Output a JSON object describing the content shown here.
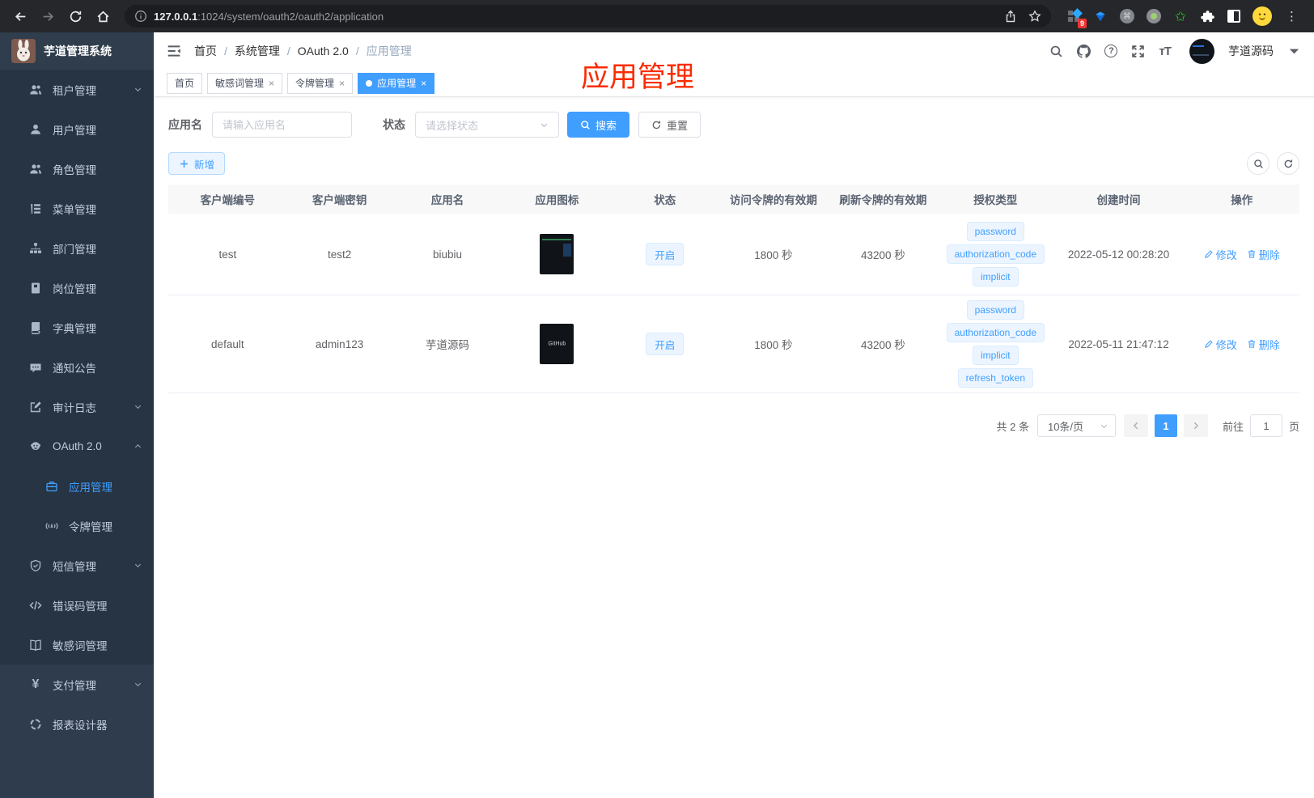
{
  "colors": {
    "accent": "#409eff",
    "annotation_red": "#fb2b00",
    "sidebar_bg": "#273444",
    "tag_bg": "#ecf5ff"
  },
  "browser": {
    "url_host": "127.0.0.1",
    "url_rest": ":1024/system/oauth2/oauth2/application",
    "ext_badge": "9"
  },
  "sidebar": {
    "title": "芋道管理系统",
    "items": [
      {
        "icon": "users-icon",
        "label": "租户管理",
        "chevron": "down",
        "sub": false,
        "light": false,
        "active": false
      },
      {
        "icon": "user-icon",
        "label": "用户管理",
        "chevron": "",
        "sub": false,
        "light": false,
        "active": false
      },
      {
        "icon": "role-icon",
        "label": "角色管理",
        "chevron": "",
        "sub": false,
        "light": false,
        "active": false
      },
      {
        "icon": "menu-tree-icon",
        "label": "菜单管理",
        "chevron": "",
        "sub": false,
        "light": false,
        "active": false
      },
      {
        "icon": "org-icon",
        "label": "部门管理",
        "chevron": "",
        "sub": false,
        "light": false,
        "active": false
      },
      {
        "icon": "badge-icon",
        "label": "岗位管理",
        "chevron": "",
        "sub": false,
        "light": false,
        "active": false
      },
      {
        "icon": "dict-icon",
        "label": "字典管理",
        "chevron": "",
        "sub": false,
        "light": false,
        "active": false
      },
      {
        "icon": "notice-icon",
        "label": "通知公告",
        "chevron": "",
        "sub": false,
        "light": false,
        "active": false
      },
      {
        "icon": "audit-icon",
        "label": "审计日志",
        "chevron": "down",
        "sub": false,
        "light": false,
        "active": false
      },
      {
        "icon": "oauth-icon",
        "label": "OAuth 2.0",
        "chevron": "up",
        "sub": false,
        "light": false,
        "active": false
      },
      {
        "icon": "briefcase-icon",
        "label": "应用管理",
        "chevron": "",
        "sub": true,
        "light": false,
        "active": true
      },
      {
        "icon": "token-icon",
        "label": "令牌管理",
        "chevron": "",
        "sub": true,
        "light": false,
        "active": false
      },
      {
        "icon": "shield-icon",
        "label": "短信管理",
        "chevron": "down",
        "sub": false,
        "light": false,
        "active": false
      },
      {
        "icon": "code-icon",
        "label": "错误码管理",
        "chevron": "",
        "sub": false,
        "light": false,
        "active": false
      },
      {
        "icon": "book-icon",
        "label": "敏感词管理",
        "chevron": "",
        "sub": false,
        "light": false,
        "active": false
      },
      {
        "icon": "yen-icon",
        "label": "支付管理",
        "chevron": "down",
        "sub": false,
        "light": true,
        "active": false
      },
      {
        "icon": "report-icon",
        "label": "报表设计器",
        "chevron": "",
        "sub": false,
        "light": true,
        "active": false
      }
    ]
  },
  "navbar": {
    "breadcrumb": [
      "首页",
      "系统管理",
      "OAuth 2.0",
      "应用管理"
    ],
    "username": "芋道源码"
  },
  "tabs": [
    {
      "label": "首页",
      "closable": false,
      "active": false
    },
    {
      "label": "敏感词管理",
      "closable": true,
      "active": false
    },
    {
      "label": "令牌管理",
      "closable": true,
      "active": false
    },
    {
      "label": "应用管理",
      "closable": true,
      "active": true
    }
  ],
  "annotation": "应用管理",
  "filters": {
    "name_label": "应用名",
    "name_placeholder": "请输入应用名",
    "status_label": "状态",
    "status_placeholder": "请选择状态",
    "search_label": "搜索",
    "reset_label": "重置",
    "add_label": "新增"
  },
  "table": {
    "columns": [
      "客户端编号",
      "客户端密钥",
      "应用名",
      "应用图标",
      "状态",
      "访问令牌的有效期",
      "刷新令牌的有效期",
      "授权类型",
      "创建时间",
      "操作"
    ],
    "edit_label": "修改",
    "delete_label": "删除",
    "rows": [
      {
        "client_id": "test",
        "secret": "test2",
        "name": "biubiu",
        "icon": "dashboard-thumbnail",
        "icon_text": "",
        "status": "开启",
        "access_ttl": "1800 秒",
        "refresh_ttl": "43200 秒",
        "grants": [
          "password",
          "authorization_code",
          "implicit"
        ],
        "created": "2022-05-12 00:28:20"
      },
      {
        "client_id": "default",
        "secret": "admin123",
        "name": "芋道源码",
        "icon": "github-thumbnail",
        "icon_text": "GitHub",
        "status": "开启",
        "access_ttl": "1800 秒",
        "refresh_ttl": "43200 秒",
        "grants": [
          "password",
          "authorization_code",
          "implicit",
          "refresh_token"
        ],
        "created": "2022-05-11 21:47:12"
      }
    ]
  },
  "pagination": {
    "total": "共 2 条",
    "page_size": "10条/页",
    "current_page": "1",
    "goto_label": "前往",
    "goto_value": "1",
    "page_suffix": "页"
  }
}
